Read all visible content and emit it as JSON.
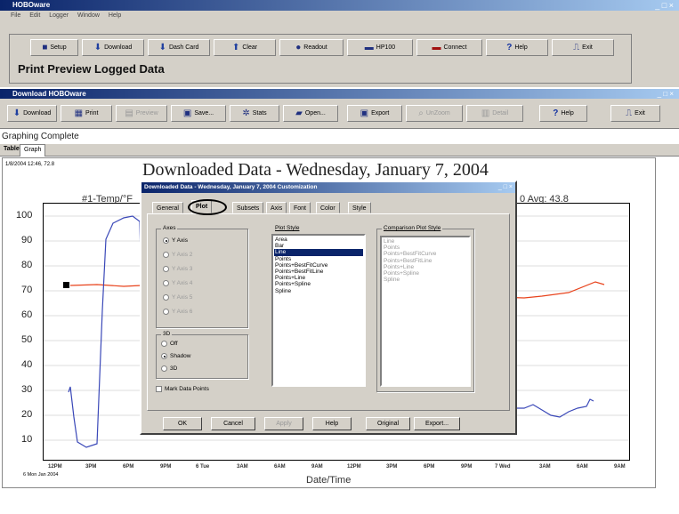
{
  "app": {
    "title": "HOBOware",
    "menu": [
      "File",
      "Edit",
      "Logger",
      "Window",
      "Help"
    ],
    "toolbar": [
      {
        "label": "Setup",
        "icon": "setup-icon"
      },
      {
        "label": "Download",
        "icon": "download-icon"
      },
      {
        "label": "Dash Card",
        "icon": "download-icon"
      },
      {
        "label": "Clear",
        "icon": "clear-icon"
      },
      {
        "label": "Readout",
        "icon": "readout-icon"
      },
      {
        "label": "HP100",
        "icon": "device-icon"
      },
      {
        "label": "Connect",
        "icon": "connect-icon"
      },
      {
        "label": "Help",
        "icon": "help-icon"
      },
      {
        "label": "Exit",
        "icon": "exit-icon"
      }
    ],
    "status_text": "Print Preview Logged Data"
  },
  "subwindow": {
    "title": "Download HOBOware",
    "toolbar": [
      {
        "label": "Download",
        "enabled": true
      },
      {
        "label": "Print",
        "enabled": true
      },
      {
        "label": "Preview",
        "enabled": false
      },
      {
        "label": "Save...",
        "enabled": true
      },
      {
        "label": "Stats",
        "enabled": true
      },
      {
        "label": "Open...",
        "enabled": true
      },
      {
        "label": "Export",
        "enabled": true
      },
      {
        "label": "UnZoom",
        "enabled": false
      },
      {
        "label": "Detail",
        "enabled": false
      },
      {
        "label": "Help",
        "enabled": true
      },
      {
        "label": "Exit",
        "enabled": true
      }
    ],
    "status": "Graphing Complete",
    "tabs": [
      "Table",
      "Graph"
    ],
    "graph": {
      "timestamp": "1/8/2004 12:46, 72.8",
      "title": "Downloaded Data - Wednesday, January 7, 2004",
      "series_label": "#1-Temp/°F",
      "avg_text": "0 Avg: 43.8",
      "y_ticks": [
        "100",
        "90",
        "80",
        "70",
        "60",
        "50",
        "40",
        "30",
        "20",
        "10"
      ],
      "x_ticks": [
        "12PM",
        "3PM",
        "6PM",
        "9PM",
        "6 Tue",
        "3AM",
        "6AM",
        "9AM",
        "12PM",
        "3PM",
        "6PM",
        "9PM",
        "7 Wed",
        "3AM",
        "6AM",
        "9AM"
      ],
      "x_start_label": "6 Mon Jan 2004",
      "xlabel": "Date/Time"
    }
  },
  "dialog": {
    "title": "Downloaded Data - Wednesday, January 7, 2004 Customization",
    "tabs": [
      "General",
      "Plot",
      "Subsets",
      "Axis",
      "Font",
      "Color",
      "Style"
    ],
    "active_tab": "Plot",
    "axes_label": "Axes",
    "axes": [
      "Y Axis",
      "Y Axis 2",
      "Y Axis 3",
      "Y Axis 4",
      "Y Axis 5",
      "Y Axis 6"
    ],
    "threed_label": "3D",
    "threed": [
      "Off",
      "Shadow",
      "3D"
    ],
    "mark_points": "Mark Data Points",
    "plot_style_label": "Plot Style",
    "plot_styles": [
      "Area",
      "Bar",
      "Line",
      "Points",
      "Points+BestFitCurve",
      "Points+BestFitLine",
      "Points+Line",
      "Points+Spline",
      "Spline"
    ],
    "selected_style": "Line",
    "comparison_label": "Comparison Plot Style",
    "comparison_styles": [
      "Line",
      "Points",
      "Points+BestFitCurve",
      "Points+BestFitLine",
      "Points+Line",
      "Points+Spline",
      "Spline"
    ],
    "buttons": [
      "OK",
      "Cancel",
      "Apply",
      "Help",
      "Original",
      "Export..."
    ]
  },
  "colors": {
    "titlebar": "#0a246a",
    "series_temp": "#e8431c",
    "series_2": "#3a48b8"
  }
}
